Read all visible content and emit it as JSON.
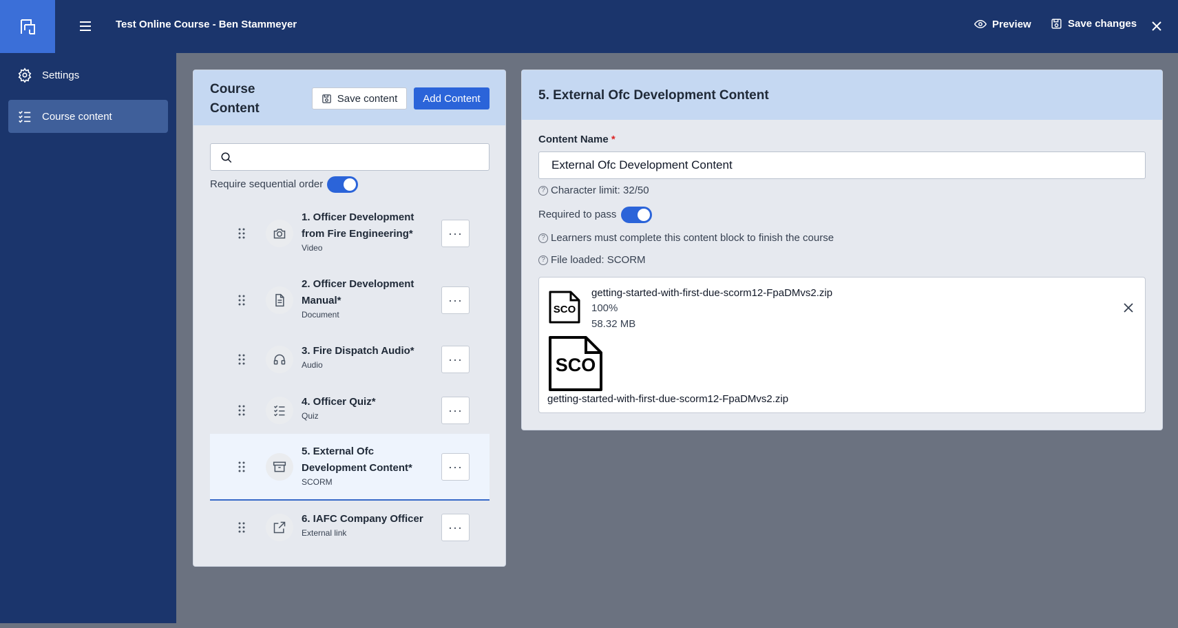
{
  "header": {
    "title": "Test Online Course - Ben Stammeyer",
    "preview_label": "Preview",
    "save_changes_label": "Save changes"
  },
  "sidebar": {
    "items": [
      {
        "label": "Settings",
        "icon": "gear-icon",
        "active": false
      },
      {
        "label": "Course content",
        "icon": "checklist-icon",
        "active": true
      }
    ]
  },
  "course_content": {
    "title": "Course Content",
    "save_content_label": "Save content",
    "add_content_label": "Add Content",
    "search_placeholder": "",
    "sequential_label": "Require sequential order",
    "sequential_on": true,
    "items": [
      {
        "title": "1. Officer Development from Fire Engineering*",
        "type": "Video",
        "icon": "camera-icon"
      },
      {
        "title": "2. Officer Development Manual*",
        "type": "Document",
        "icon": "document-icon"
      },
      {
        "title": "3. Fire Dispatch Audio*",
        "type": "Audio",
        "icon": "headset-icon"
      },
      {
        "title": "4. Officer Quiz*",
        "type": "Quiz",
        "icon": "checklist-icon"
      },
      {
        "title": "5. External Ofc Development Content*",
        "type": "SCORM",
        "icon": "archive-icon",
        "selected": true
      },
      {
        "title": "6. IAFC Company Officer",
        "type": "External link",
        "icon": "external-link-icon"
      }
    ],
    "more_label": "···"
  },
  "detail": {
    "title": "5. External Ofc Development Content",
    "content_name_label": "Content Name",
    "required_marker": "*",
    "content_name_value": "External Ofc Development Content",
    "char_limit": "Character limit: 32/50",
    "required_to_pass_label": "Required to pass",
    "required_to_pass_on": true,
    "learners_hint": "Learners must complete this content block to finish the course",
    "file_loaded": "File loaded: SCORM",
    "file": {
      "name": "getting-started-with-first-due-scorm12-FpaDMvs2.zip",
      "progress": "100%",
      "size": "58.32 MB",
      "icon_text": "SCO"
    }
  },
  "colors": {
    "topbar": "#1b356c",
    "accent": "#2b64d9",
    "panel_header": "#c5d8f2",
    "backdrop": "#6b7280"
  }
}
